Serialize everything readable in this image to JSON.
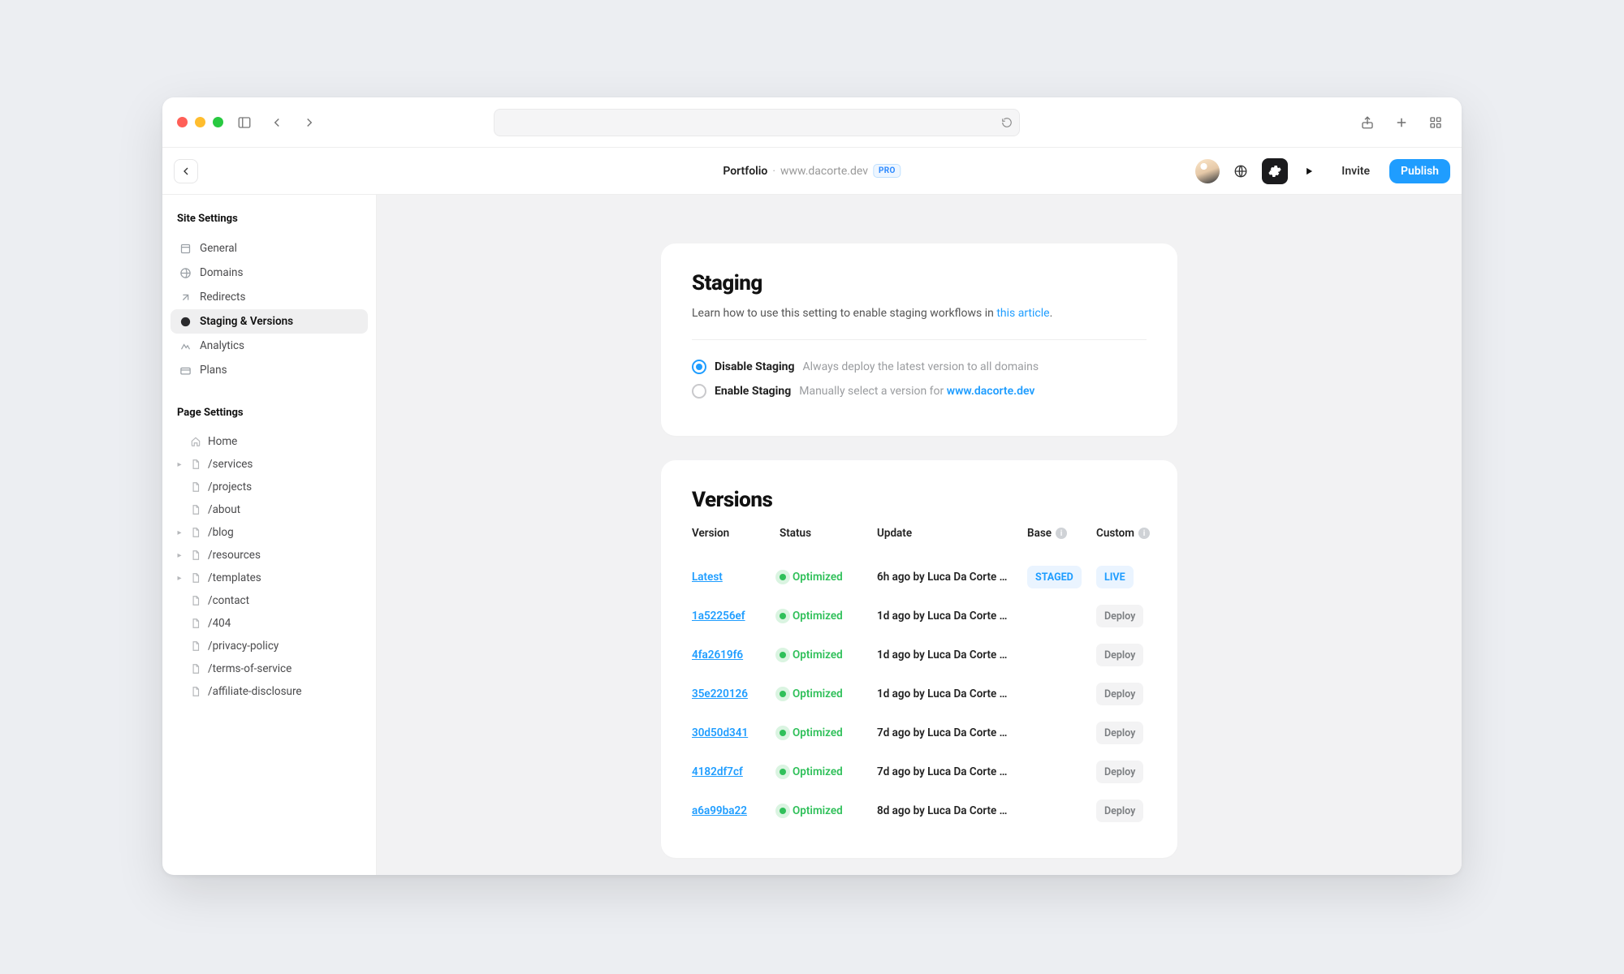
{
  "header": {
    "project": "Portfolio",
    "domain": "www.dacorte.dev",
    "plan_badge": "PRO",
    "invite": "Invite",
    "publish": "Publish"
  },
  "sidebar": {
    "site_title": "Site Settings",
    "site_items": [
      {
        "label": "General"
      },
      {
        "label": "Domains"
      },
      {
        "label": "Redirects"
      },
      {
        "label": "Staging & Versions",
        "active": true
      },
      {
        "label": "Analytics"
      },
      {
        "label": "Plans"
      }
    ],
    "page_title": "Page Settings",
    "page_items": [
      {
        "label": "Home",
        "expandable": false,
        "home": true
      },
      {
        "label": "/services",
        "expandable": true
      },
      {
        "label": "/projects",
        "expandable": false
      },
      {
        "label": "/about",
        "expandable": false
      },
      {
        "label": "/blog",
        "expandable": true
      },
      {
        "label": "/resources",
        "expandable": true
      },
      {
        "label": "/templates",
        "expandable": true
      },
      {
        "label": "/contact",
        "expandable": false
      },
      {
        "label": "/404",
        "expandable": false
      },
      {
        "label": "/privacy-policy",
        "expandable": false
      },
      {
        "label": "/terms-of-service",
        "expandable": false
      },
      {
        "label": "/affiliate-disclosure",
        "expandable": false
      }
    ]
  },
  "staging": {
    "title": "Staging",
    "desc_prefix": "Learn how to use this setting to enable staging workflows in ",
    "desc_link": "this article",
    "desc_suffix": ".",
    "disable_label": "Disable Staging",
    "disable_hint": "Always deploy the latest version to all domains",
    "enable_label": "Enable Staging",
    "enable_hint_prefix": "Manually select a version for ",
    "enable_hint_domain": "www.dacorte.dev"
  },
  "versions": {
    "title": "Versions",
    "cols": {
      "version": "Version",
      "status": "Status",
      "update": "Update",
      "base": "Base",
      "custom": "Custom"
    },
    "staged": "STAGED",
    "live": "LIVE",
    "deploy": "Deploy",
    "optimized": "Optimized",
    "rows": [
      {
        "id": "Latest",
        "update": "6h ago by Luca Da Corte …",
        "base": "STAGED",
        "custom": "LIVE"
      },
      {
        "id": "1a52256ef",
        "update": "1d ago by Luca Da Corte …"
      },
      {
        "id": "4fa2619f6",
        "update": "1d ago by Luca Da Corte …"
      },
      {
        "id": "35e220126",
        "update": "1d ago by Luca Da Corte …"
      },
      {
        "id": "30d50d341",
        "update": "7d ago by Luca Da Corte …"
      },
      {
        "id": "4182df7cf",
        "update": "7d ago by Luca Da Corte …"
      },
      {
        "id": "a6a99ba22",
        "update": "8d ago by Luca Da Corte …"
      }
    ]
  }
}
